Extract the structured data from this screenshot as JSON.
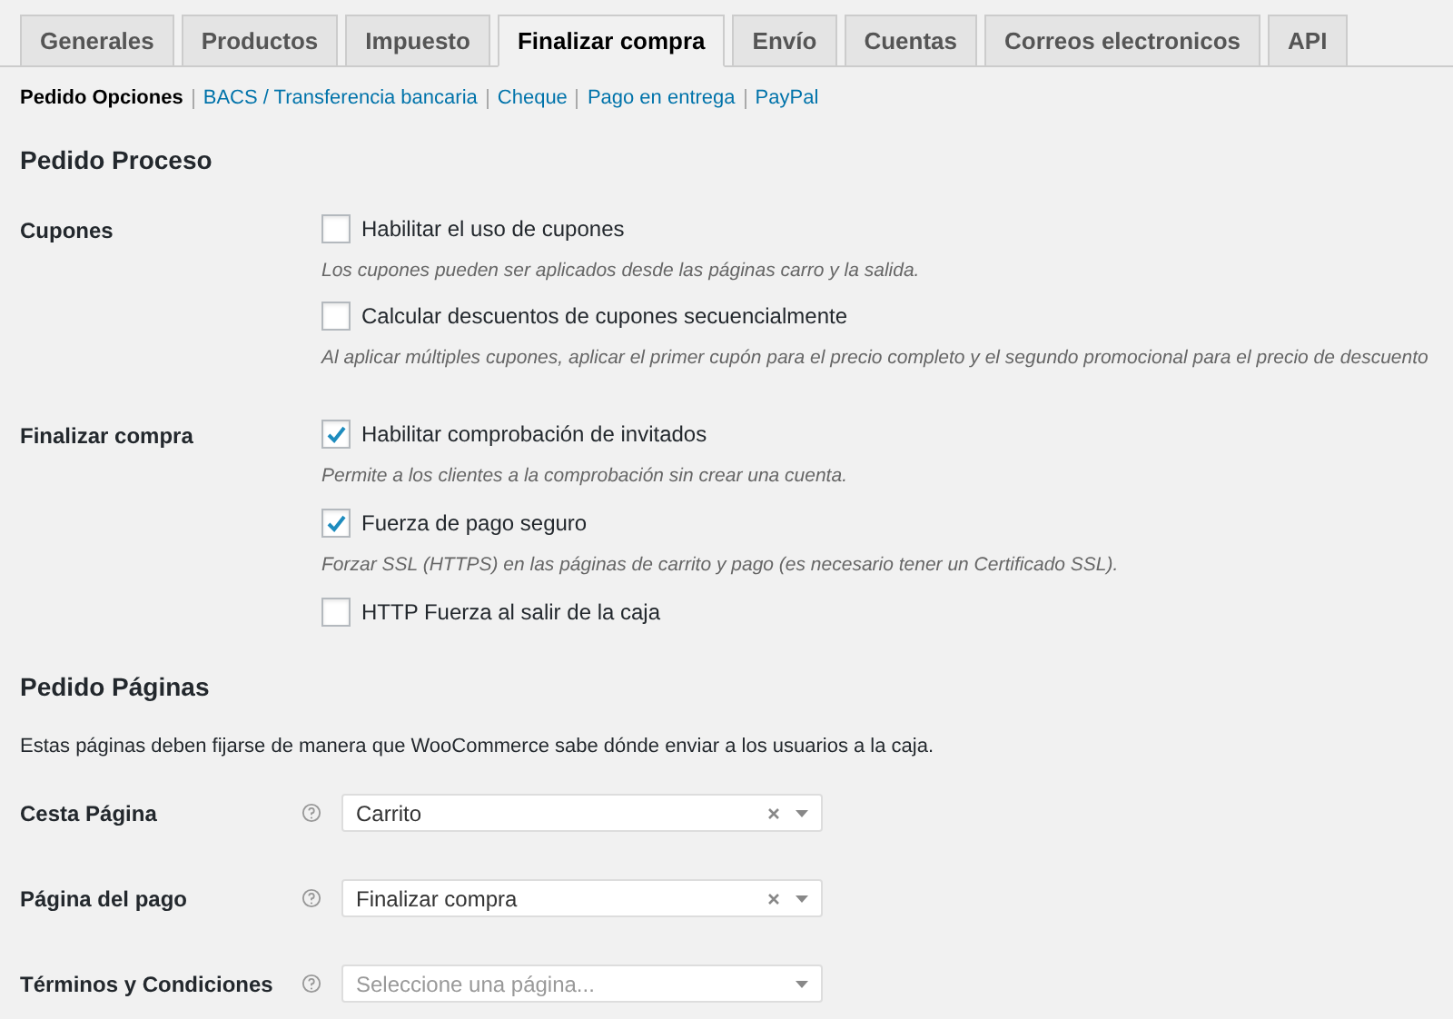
{
  "tabs": [
    {
      "label": "Generales",
      "selected": false
    },
    {
      "label": "Productos",
      "selected": false
    },
    {
      "label": "Impuesto",
      "selected": false
    },
    {
      "label": "Finalizar compra",
      "selected": true
    },
    {
      "label": "Envío",
      "selected": false
    },
    {
      "label": "Cuentas",
      "selected": false
    },
    {
      "label": "Correos electronicos",
      "selected": false
    },
    {
      "label": "API",
      "selected": false
    }
  ],
  "subnav": [
    {
      "label": "Pedido Opciones",
      "selected": true
    },
    {
      "label": "BACS / Transferencia bancaria",
      "selected": false
    },
    {
      "label": "Cheque",
      "selected": false
    },
    {
      "label": "Pago en entrega",
      "selected": false
    },
    {
      "label": "PayPal",
      "selected": false
    }
  ],
  "process": {
    "heading": "Pedido Proceso",
    "groups": [
      {
        "label": "Cupones",
        "options": [
          {
            "label": "Habilitar el uso de cupones",
            "checked": false,
            "description": "Los cupones pueden ser aplicados desde las páginas carro y la salida."
          },
          {
            "label": "Calcular descuentos de cupones secuencialmente",
            "checked": false,
            "description": "Al aplicar múltiples cupones, aplicar el primer cupón para el precio completo y el segundo promocional para el precio de descuento"
          }
        ]
      },
      {
        "label": "Finalizar compra",
        "options": [
          {
            "label": "Habilitar comprobación de invitados",
            "checked": true,
            "description": "Permite a los clientes a la comprobación sin crear una cuenta."
          },
          {
            "label": "Fuerza de pago seguro",
            "checked": true,
            "description": "Forzar SSL (HTTPS) en las páginas de carrito y pago (es necesario tener un Certificado SSL)."
          },
          {
            "label": "HTTP Fuerza al salir de la caja",
            "checked": false
          }
        ]
      }
    ]
  },
  "pages": {
    "heading": "Pedido Páginas",
    "intro": "Estas páginas deben fijarse de manera que WooCommerce sabe dónde enviar a los usuarios a la caja.",
    "fields": [
      {
        "label": "Cesta Página",
        "value": "Carrito"
      },
      {
        "label": "Página del pago",
        "value": "Finalizar compra"
      },
      {
        "label": "Términos y Condiciones",
        "placeholder": "Seleccione una página..."
      }
    ]
  }
}
